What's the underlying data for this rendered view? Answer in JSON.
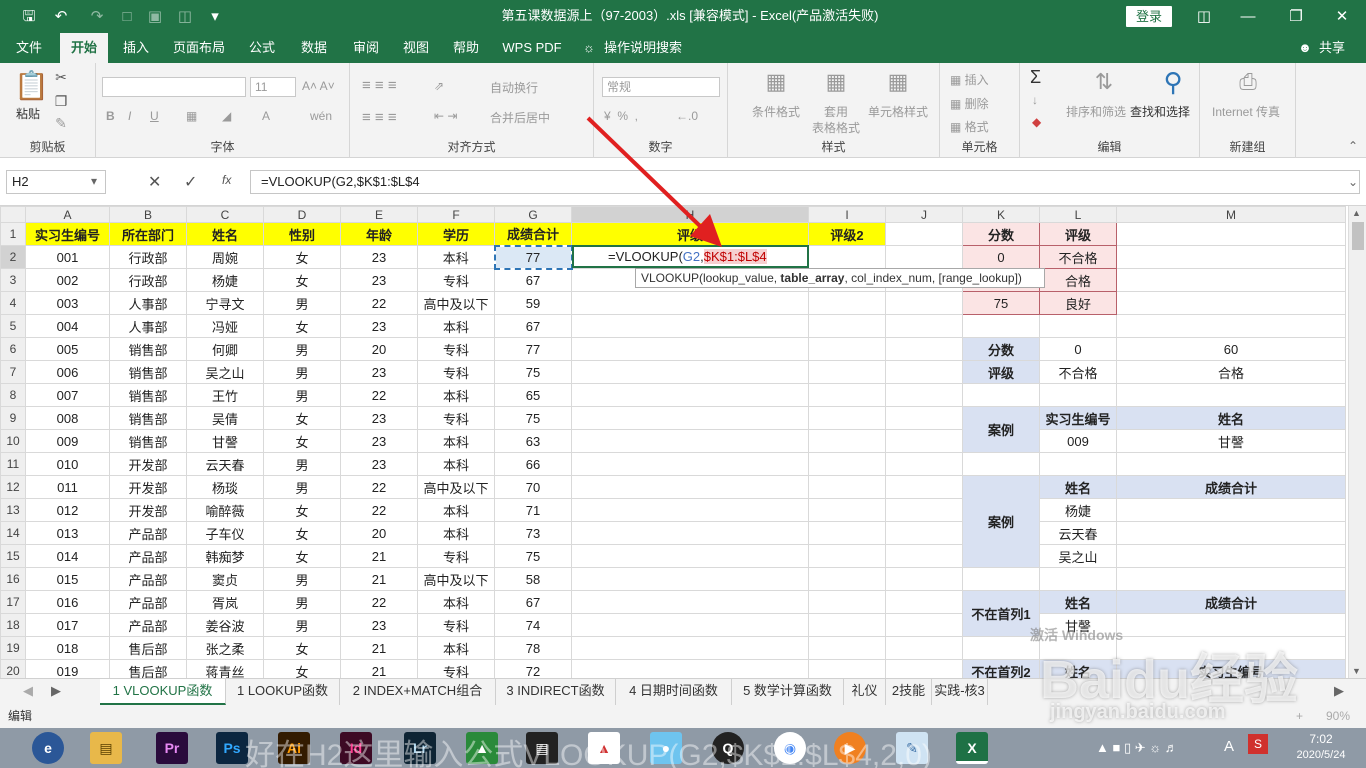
{
  "window": {
    "title": "第五课数据源上（97-2003）.xls [兼容模式] - Excel(产品激活失败)",
    "login": "登录"
  },
  "menu": {
    "tabs": [
      "文件",
      "开始",
      "插入",
      "页面布局",
      "公式",
      "数据",
      "审阅",
      "视图",
      "帮助",
      "WPS PDF"
    ],
    "tell_me": "操作说明搜索",
    "share": "共享"
  },
  "ribbon": {
    "clipboard": {
      "paste": "粘贴",
      "label": "剪贴板"
    },
    "font": {
      "label": "字体",
      "size": "11"
    },
    "align": {
      "wrap": "自动换行",
      "merge": "合并后居中",
      "label": "对齐方式"
    },
    "number": {
      "format": "常规",
      "label": "数字"
    },
    "styles": {
      "cond": "条件格式",
      "table": "套用",
      "table2": "表格格式",
      "cell": "单元格样式",
      "label": "样式"
    },
    "cells": {
      "insert": "插入",
      "delete": "删除",
      "format": "格式",
      "label": "单元格"
    },
    "edit": {
      "sort": "排序和筛选",
      "find": "查找和选择",
      "label": "编辑"
    },
    "newgroup": {
      "internet": "Internet 传真",
      "label": "新建组"
    }
  },
  "formula_bar": {
    "cell_ref": "H2",
    "formula": "=VLOOKUP(G2,$K$1:$L$4",
    "fx": "fx"
  },
  "edit_cell": {
    "prefix": "=VLOOKUP(",
    "ref1": "G2",
    "comma": ",",
    "ref2": "$K$1:$L$4"
  },
  "tooltip": {
    "fn": "VLOOKUP(lookup_value, ",
    "bold": "table_array",
    "rest": ", col_index_num, [range_lookup])"
  },
  "columns": [
    "A",
    "B",
    "C",
    "D",
    "E",
    "F",
    "G",
    "H",
    "I",
    "J",
    "K",
    "L",
    "M"
  ],
  "headers": [
    "实习生编号",
    "所在部门",
    "姓名",
    "性别",
    "年龄",
    "学历",
    "成绩合计",
    "评级",
    "评级2"
  ],
  "rows": [
    [
      "001",
      "行政部",
      "周婉",
      "女",
      "23",
      "本科",
      "77"
    ],
    [
      "002",
      "行政部",
      "杨婕",
      "女",
      "23",
      "专科",
      "67"
    ],
    [
      "003",
      "人事部",
      "宁寻文",
      "男",
      "22",
      "高中及以下",
      "59"
    ],
    [
      "004",
      "人事部",
      "冯娅",
      "女",
      "23",
      "本科",
      "67"
    ],
    [
      "005",
      "销售部",
      "何卿",
      "男",
      "20",
      "专科",
      "77"
    ],
    [
      "006",
      "销售部",
      "吴之山",
      "男",
      "23",
      "专科",
      "75"
    ],
    [
      "007",
      "销售部",
      "王竹",
      "男",
      "22",
      "本科",
      "65"
    ],
    [
      "008",
      "销售部",
      "吴倩",
      "女",
      "23",
      "专科",
      "75"
    ],
    [
      "009",
      "销售部",
      "甘謦",
      "女",
      "23",
      "本科",
      "63"
    ],
    [
      "010",
      "开发部",
      "云天春",
      "男",
      "23",
      "本科",
      "66"
    ],
    [
      "011",
      "开发部",
      "杨琰",
      "男",
      "22",
      "高中及以下",
      "70"
    ],
    [
      "012",
      "开发部",
      "喻醉薇",
      "女",
      "22",
      "本科",
      "71"
    ],
    [
      "013",
      "产品部",
      "子车仪",
      "女",
      "20",
      "本科",
      "73"
    ],
    [
      "014",
      "产品部",
      "韩痴梦",
      "女",
      "21",
      "专科",
      "75"
    ],
    [
      "015",
      "产品部",
      "窦贞",
      "男",
      "21",
      "高中及以下",
      "58"
    ],
    [
      "016",
      "产品部",
      "胥岚",
      "男",
      "22",
      "本科",
      "67"
    ],
    [
      "017",
      "产品部",
      "姜谷波",
      "男",
      "23",
      "专科",
      "74"
    ],
    [
      "018",
      "售后部",
      "张之柔",
      "女",
      "21",
      "本科",
      "78"
    ],
    [
      "019",
      "售后部",
      "蒋青丝",
      "女",
      "21",
      "专科",
      "72"
    ]
  ],
  "lookup": {
    "h_score": "分数",
    "h_grade": "评级",
    "r2": [
      "0",
      "不合格"
    ],
    "r3": [
      "",
      "合格"
    ],
    "r4": [
      "75",
      "良好"
    ]
  },
  "hlookup": {
    "score": "分数",
    "grade": "评级",
    "s1": "0",
    "s2": "60",
    "g1": "不合格",
    "g2": "合格"
  },
  "case1": {
    "label": "案例",
    "h_id": "实习生编号",
    "h_name": "姓名",
    "id": "009",
    "name": "甘謦"
  },
  "case2": {
    "label": "案例",
    "h_name": "姓名",
    "h_total": "成绩合计",
    "names": [
      "杨婕",
      "云天春",
      "吴之山"
    ]
  },
  "case3": {
    "label": "不在首列1",
    "h_name": "姓名",
    "h_total": "成绩合计",
    "name": "甘謦"
  },
  "case4": {
    "label": "不在首列2",
    "h_name": "姓名",
    "h_id": "实习生编号"
  },
  "sheet_tabs": [
    "1 VLOOKUP函数",
    "1 LOOKUP函数",
    "2 INDEX+MATCH组合",
    "3 INDIRECT函数",
    "4 日期时间函数",
    "5 数学计算函数",
    "礼仪",
    "2技能",
    "实践-核3"
  ],
  "status": {
    "mode": "编辑",
    "zoom": "90%"
  },
  "taskbar": {
    "time": "7:02",
    "date": "2020/5/24",
    "ime": "A"
  },
  "overlay": {
    "watermark": "Baidu经验",
    "watermark_url": "jingyan.baidu.com",
    "caption": "好在H2这里输入公式VLOOKUP(G2,$K$1:$L$4,2,0)",
    "activate": "激活 Windows"
  }
}
